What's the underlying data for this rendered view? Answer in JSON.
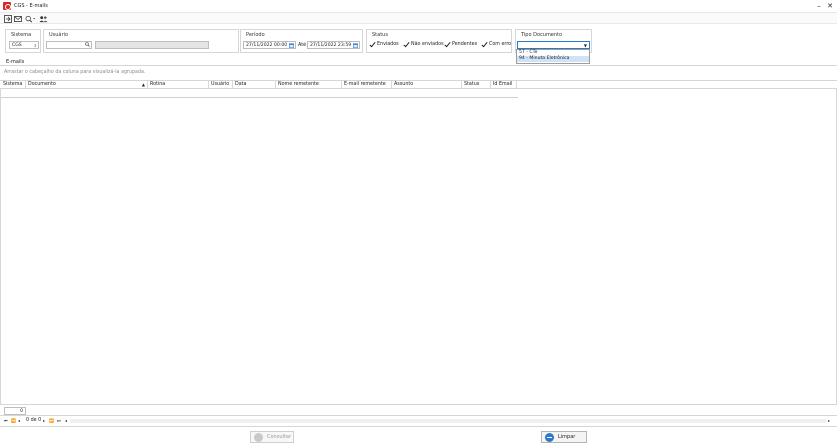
{
  "window": {
    "title": "CGS - E-mails",
    "minimize": "–",
    "close": "✕"
  },
  "toolbar": {
    "icons": [
      "exit-icon",
      "email-icon",
      "zoom-icon",
      "users-icon"
    ]
  },
  "filters": {
    "sistema": {
      "title": "Sistema",
      "value": "CGS"
    },
    "usuario": {
      "title": "Usuário",
      "value": "",
      "name_value": ""
    },
    "periodo": {
      "title": "Período",
      "from": "27/11/2022 00:00",
      "to_label": "Até",
      "to": "27/11/2022 23:59"
    },
    "status": {
      "title": "Status",
      "options": [
        {
          "label": "Enviados",
          "checked": true
        },
        {
          "label": "Não enviados",
          "checked": true
        },
        {
          "label": "Pendentes",
          "checked": true
        },
        {
          "label": "Com erro",
          "checked": true
        }
      ]
    },
    "tipo_documento": {
      "title": "Tipo Documento",
      "value": "",
      "options": [
        "57 - CTe",
        "94 - Minuta Eletrônica"
      ],
      "highlighted_index": 1
    }
  },
  "tab": {
    "label": "E-mails"
  },
  "group_hint": "Arrastar o cabeçalho da coluna para visualizá-la agrupada.",
  "grid": {
    "columns": [
      "Sistema",
      "Documento",
      "Rotina",
      "Usuário",
      "Data",
      "Nome remetente",
      "E-mail remetente",
      "Assunto",
      "Status",
      "Id Email"
    ]
  },
  "footer": {
    "count": "0",
    "page_info": "0 de 0"
  },
  "buttons": {
    "consultar": "Consultar",
    "limpar": "Limpar"
  },
  "colors": {
    "brand": "#d9262c",
    "accent": "#2b79c9",
    "selection": "#cfe3f7"
  }
}
